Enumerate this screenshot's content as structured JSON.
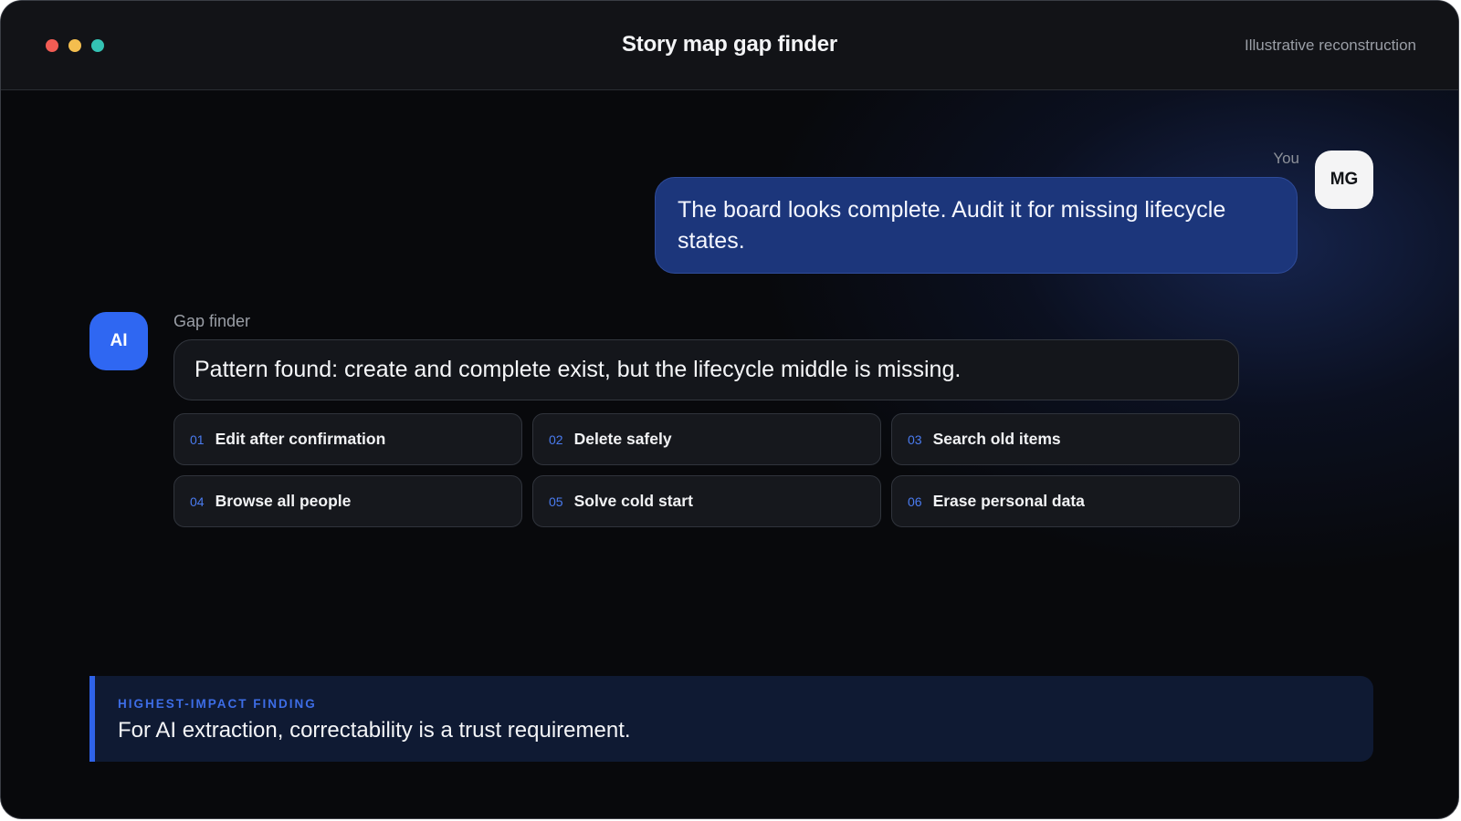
{
  "window": {
    "title": "Story map gap finder",
    "header_note": "Illustrative reconstruction",
    "controls": [
      "close",
      "minimize",
      "zoom"
    ]
  },
  "user_message": {
    "sender_label": "You",
    "avatar_initials": "MG",
    "text": "The board looks complete. Audit it for missing lifecycle states."
  },
  "ai_message": {
    "sender_label": "Gap finder",
    "avatar_initials": "AI",
    "text": "Pattern found: create and complete exist, but the lifecycle middle is missing.",
    "gaps": [
      {
        "num": "01",
        "label": "Edit after confirmation"
      },
      {
        "num": "02",
        "label": "Delete safely"
      },
      {
        "num": "03",
        "label": "Search old items"
      },
      {
        "num": "04",
        "label": "Browse all people"
      },
      {
        "num": "05",
        "label": "Solve cold start"
      },
      {
        "num": "06",
        "label": "Erase personal data"
      }
    ]
  },
  "finding": {
    "label": "HIGHEST-IMPACT FINDING",
    "text": "For AI extraction, correctability is a trust requirement."
  },
  "colors": {
    "accent": "#2f67f2",
    "user_bubble": "#1c367b",
    "background": "#08090c"
  }
}
